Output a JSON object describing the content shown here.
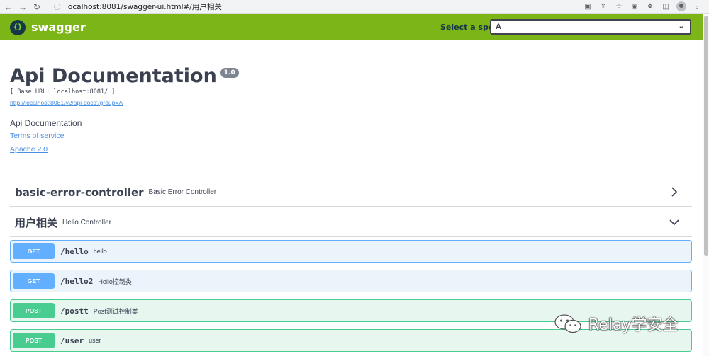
{
  "browser": {
    "url": "localhost:8081/swagger-ui.html#/用户相关"
  },
  "topbar": {
    "brand": "swagger",
    "spec_label": "Select a spec",
    "spec_value": "A"
  },
  "info": {
    "title": "Api Documentation",
    "version": "1.0",
    "base_url": "[ Base URL: localhost:8081/ ]",
    "api_docs_link": "http://localhost:8081/v2/api-docs?group=A",
    "description": "Api Documentation",
    "terms_link": "Terms of service",
    "license_link": "Apache 2.0"
  },
  "tags": [
    {
      "name": "basic-error-controller",
      "description": "Basic Error Controller",
      "expanded": false
    },
    {
      "name": "用户相关",
      "description": "Hello Controller",
      "expanded": true
    }
  ],
  "operations": [
    {
      "method": "GET",
      "path": "/hello",
      "summary": "hello"
    },
    {
      "method": "GET",
      "path": "/hello2",
      "summary": "Hello控制类"
    },
    {
      "method": "POST",
      "path": "/postt",
      "summary": "Post测试控制类"
    },
    {
      "method": "POST",
      "path": "/user",
      "summary": "user"
    }
  ],
  "watermark": {
    "text": "Relay学安全"
  },
  "colors": {
    "topbar": "#7cb518",
    "get": "#61affe",
    "post": "#49cc90",
    "link": "#4990e2"
  }
}
